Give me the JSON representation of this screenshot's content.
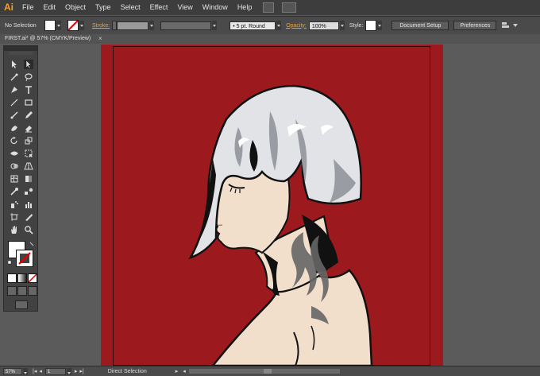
{
  "app": {
    "logo": "Ai",
    "menu": [
      "File",
      "Edit",
      "Object",
      "Type",
      "Select",
      "Effect",
      "View",
      "Window",
      "Help"
    ],
    "menu_icons": [
      "bridge-icon",
      "arrange-documents-icon"
    ]
  },
  "control_bar": {
    "selection_label": "No Selection",
    "fill_color": "#ffffff",
    "stroke_label": "Stroke:",
    "brush_value": "5 pt. Round",
    "opacity_label": "Opacity:",
    "opacity_value": "100%",
    "style_label": "Style:",
    "document_setup": "Document Setup",
    "preferences": "Preferences"
  },
  "document": {
    "tab_title": "FIRST.ai* @ 57% (CMYK/Preview)",
    "close_glyph": "×",
    "artboard_color": "#9c1a1e"
  },
  "status_bar": {
    "zoom": "57%",
    "artboard_number": "1",
    "current_tool": "Direct Selection"
  },
  "tools": [
    "selection-tool-icon",
    "direct-selection-tool-icon",
    "magic-wand-tool-icon",
    "lasso-tool-icon",
    "pen-tool-icon",
    "type-tool-icon",
    "line-segment-tool-icon",
    "rectangle-tool-icon",
    "paintbrush-tool-icon",
    "pencil-tool-icon",
    "blob-brush-tool-icon",
    "eraser-tool-icon",
    "rotate-tool-icon",
    "scale-tool-icon",
    "width-tool-icon",
    "free-transform-tool-icon",
    "shape-builder-tool-icon",
    "perspective-grid-tool-icon",
    "mesh-tool-icon",
    "gradient-tool-icon",
    "eyedropper-tool-icon",
    "blend-tool-icon",
    "symbol-sprayer-tool-icon",
    "column-graph-tool-icon",
    "artboard-tool-icon",
    "slice-tool-icon",
    "hand-tool-icon",
    "zoom-tool-icon"
  ]
}
